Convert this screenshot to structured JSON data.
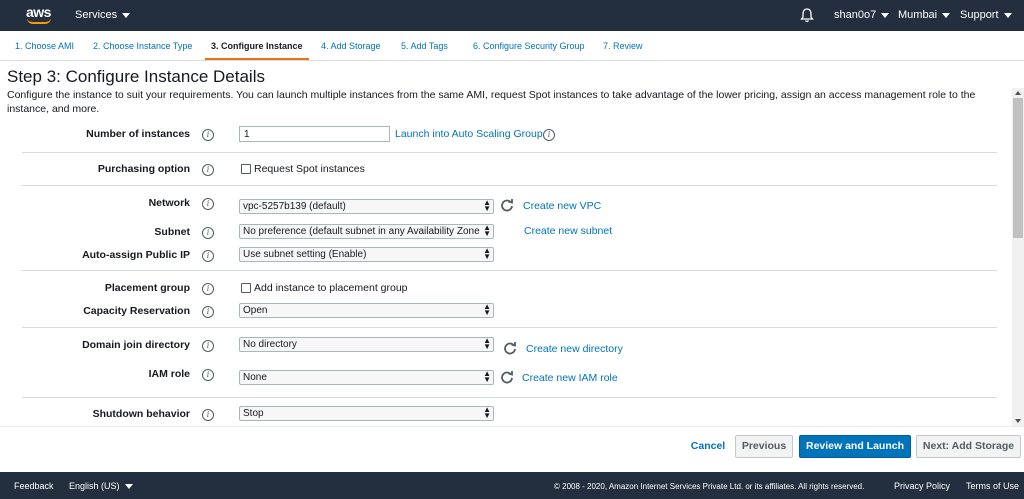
{
  "topnav": {
    "logo": "aws",
    "services": "Services",
    "user": "shan0o7",
    "region": "Mumbai",
    "support": "Support"
  },
  "steps": [
    {
      "label": "1. Choose AMI"
    },
    {
      "label": "2. Choose Instance Type"
    },
    {
      "label": "3. Configure Instance"
    },
    {
      "label": "4. Add Storage"
    },
    {
      "label": "5. Add Tags"
    },
    {
      "label": "6. Configure Security Group"
    },
    {
      "label": "7. Review"
    }
  ],
  "page": {
    "title": "Step 3: Configure Instance Details",
    "description": "Configure the instance to suit your requirements. You can launch multiple instances from the same AMI, request Spot instances to take advantage of the lower pricing, assign an access management role to the instance, and more."
  },
  "form": {
    "info_icon": "i",
    "number_of_instances": {
      "label": "Number of instances",
      "value": "1",
      "link": "Launch into Auto Scaling Group"
    },
    "purchasing_option": {
      "label": "Purchasing option",
      "checkbox": "Request Spot instances"
    },
    "network": {
      "label": "Network",
      "value": "vpc-5257b139 (default)",
      "link": "Create new VPC"
    },
    "subnet": {
      "label": "Subnet",
      "value": "No preference (default subnet in any Availability Zone",
      "link": "Create new subnet"
    },
    "public_ip": {
      "label": "Auto-assign Public IP",
      "value": "Use subnet setting (Enable)"
    },
    "placement_group": {
      "label": "Placement group",
      "checkbox": "Add instance to placement group"
    },
    "capacity_reservation": {
      "label": "Capacity Reservation",
      "value": "Open"
    },
    "domain_join": {
      "label": "Domain join directory",
      "value": "No directory",
      "link": "Create new directory"
    },
    "iam_role": {
      "label": "IAM role",
      "value": "None",
      "link": "Create new IAM role"
    },
    "shutdown": {
      "label": "Shutdown behavior",
      "value": "Stop"
    }
  },
  "actions": {
    "cancel": "Cancel",
    "previous": "Previous",
    "review": "Review and Launch",
    "next": "Next: Add Storage"
  },
  "footer": {
    "feedback": "Feedback",
    "language": "English (US)",
    "copyright": "© 2008 - 2020, Amazon Internet Services Private Ltd. or its affiliates. All rights reserved.",
    "privacy": "Privacy Policy",
    "terms": "Terms of Use"
  },
  "colors": {
    "nav_bg": "#232f3e",
    "link": "#0073bb",
    "primary_button": "#0073bb",
    "active_step_underline": "#ec7211"
  }
}
